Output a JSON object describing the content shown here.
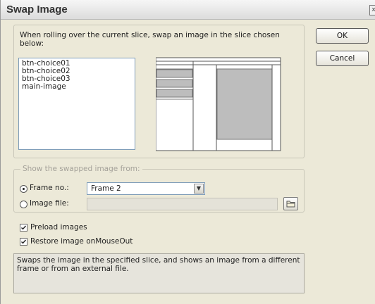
{
  "window": {
    "title": "Swap Image",
    "close_glyph": "x"
  },
  "instruction": "When rolling over the current slice, swap an image in the slice chosen below:",
  "slices": [
    "btn-choice01",
    "btn-choice02",
    "btn-choice03",
    "main-image"
  ],
  "buttons": {
    "ok": "OK",
    "cancel": "Cancel"
  },
  "source_group": {
    "legend": "Show the swapped image from:",
    "frame_option": {
      "label": "Frame no.:",
      "selected": true
    },
    "frame_select": {
      "value": "Frame 2"
    },
    "file_option": {
      "label": "Image file:",
      "selected": false
    },
    "file_input": {
      "value": ""
    }
  },
  "options": {
    "preload": {
      "label": "Preload images",
      "checked": true
    },
    "restore": {
      "label": "Restore image onMouseOut",
      "checked": true
    }
  },
  "description": "Swaps the image in the specified slice, and shows an image from a different frame or from an external file.",
  "icons": {
    "dropdown": "chevron-down-icon",
    "browse": "folder-icon",
    "check": "check-icon",
    "close": "close-icon"
  },
  "colors": {
    "dialog_bg": "#ece9d8",
    "preview_selected_slice": "#bdbdbd"
  }
}
